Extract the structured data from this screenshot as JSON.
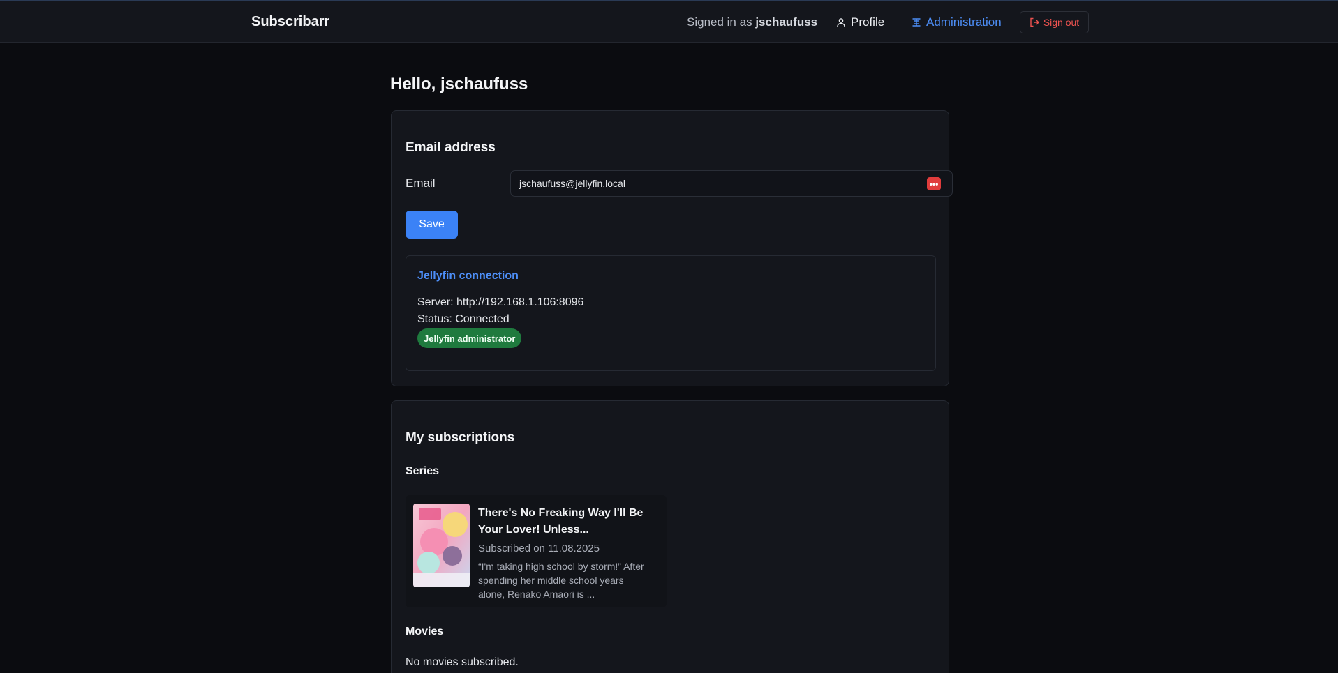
{
  "header": {
    "brand": "Subscribarr",
    "signed_in_prefix": "Signed in as",
    "username": "jschaufuss",
    "nav": {
      "profile": "Profile",
      "administration": "Administration",
      "sign_out": "Sign out"
    }
  },
  "greeting": "Hello, jschaufuss",
  "email_card": {
    "title": "Email address",
    "email_label": "Email",
    "email_value": "jschaufuss@jellyfin.local",
    "password_manager_icon": "dots-icon",
    "save_label": "Save",
    "jellyfin": {
      "title": "Jellyfin connection",
      "server": "Server: http://192.168.1.106:8096",
      "status": "Status: Connected",
      "badge": "Jellyfin administrator"
    }
  },
  "subscriptions_card": {
    "title": "My subscriptions",
    "series_label": "Series",
    "series": [
      {
        "title": "There's No Freaking Way I'll Be Your Lover! Unless...",
        "subscribed": "Subscribed on 11.08.2025",
        "description": "“I'm taking high school by storm!” After spending her middle school years alone, Renako Amaori is ..."
      }
    ],
    "movies_label": "Movies",
    "movies_empty": "No movies subscribed."
  },
  "colors": {
    "accent": "#3b82f6",
    "link": "#4d8ef7",
    "danger": "#ef5350",
    "success_badge": "#1f7a3e",
    "background": "#0b0c10",
    "card": "#14161c"
  }
}
